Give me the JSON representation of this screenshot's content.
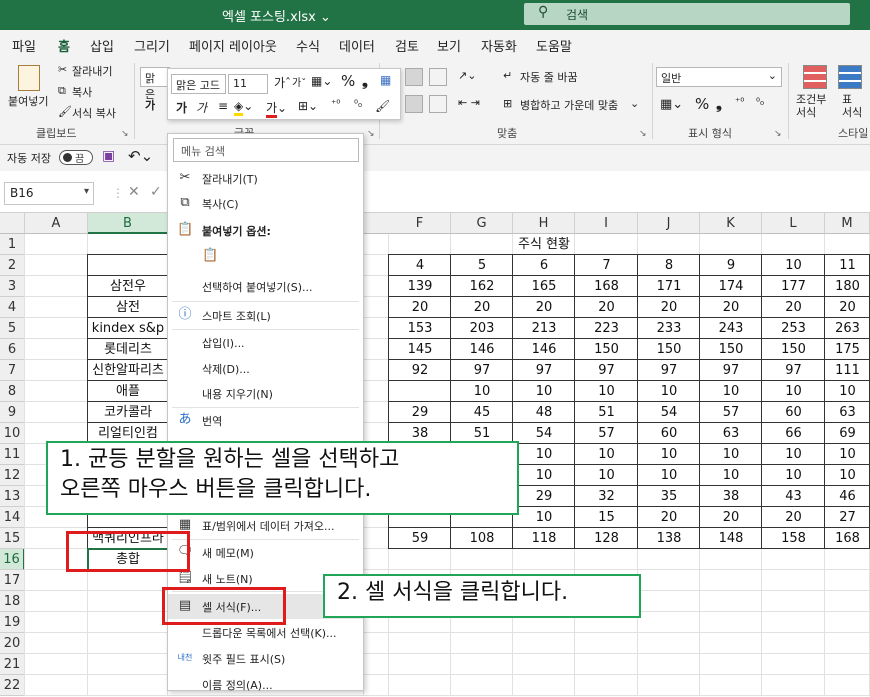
{
  "title_bar": {
    "title": "엑셀 포스팅.xlsx ⌄",
    "search_placeholder": "검색"
  },
  "tabs": [
    "파일",
    "홈",
    "삽입",
    "그리기",
    "페이지 레이아웃",
    "수식",
    "데이터",
    "검토",
    "보기",
    "자동화",
    "도움말"
  ],
  "active_tab": "홈",
  "ribbon": {
    "paste": "붙여넣기",
    "cut": "잘라내기",
    "copy": "복사",
    "format_painter": "서식 복사",
    "clipboard": "클립보드",
    "font_group": "글꼴",
    "font_name": "맑은",
    "wrap_text": "자동 줄 바꿈",
    "merge_center": "병합하고 가운데 맞춤",
    "alignment": "맞춤",
    "number_format": "일반",
    "number_group": "표시 형식",
    "conditional_format": "조건부\n서식",
    "table_format": "표\n서식",
    "styles": "스타일"
  },
  "mini_toolbar": {
    "font": "맑은 고드",
    "size": "11"
  },
  "qat": {
    "autosave": "자동 저장",
    "toggle": "끔"
  },
  "name_box": "B16",
  "grid": {
    "columns": [
      "A",
      "B",
      "F",
      "G",
      "H",
      "I",
      "J",
      "K",
      "L",
      "M"
    ],
    "rows": [
      "1",
      "2",
      "3",
      "4",
      "5",
      "6",
      "7",
      "8",
      "9",
      "10",
      "11",
      "12",
      "13",
      "14",
      "15",
      "16",
      "17",
      "18",
      "19",
      "20",
      "21",
      "22"
    ],
    "table_title": "주식 현황",
    "header_numbers": [
      "4",
      "5",
      "6",
      "7",
      "8",
      "9",
      "10",
      "11"
    ],
    "stock_names": [
      "삼전우",
      "삼전",
      "kindex s&p",
      "롯데리츠",
      "신한알파리츠",
      "애플",
      "코카콜라",
      "리얼티인컴",
      "",
      "",
      "",
      "",
      "맥쿼리인프라"
    ],
    "total_label": "총합",
    "data": [
      [
        "139",
        "162",
        "165",
        "168",
        "171",
        "174",
        "177",
        "180"
      ],
      [
        "20",
        "20",
        "20",
        "20",
        "20",
        "20",
        "20",
        "20"
      ],
      [
        "153",
        "203",
        "213",
        "223",
        "233",
        "243",
        "253",
        "263"
      ],
      [
        "145",
        "146",
        "146",
        "150",
        "150",
        "150",
        "150",
        "175"
      ],
      [
        "92",
        "97",
        "97",
        "97",
        "97",
        "97",
        "97",
        "111"
      ],
      [
        "",
        "10",
        "10",
        "10",
        "10",
        "10",
        "10",
        "10"
      ],
      [
        "29",
        "45",
        "48",
        "51",
        "54",
        "57",
        "60",
        "63"
      ],
      [
        "38",
        "51",
        "54",
        "57",
        "60",
        "63",
        "66",
        "69"
      ],
      [
        "",
        "",
        "10",
        "10",
        "10",
        "10",
        "10",
        "10"
      ],
      [
        "",
        "",
        "10",
        "10",
        "10",
        "10",
        "10",
        "10"
      ],
      [
        "",
        "",
        "29",
        "32",
        "35",
        "38",
        "43",
        "46"
      ],
      [
        "",
        "",
        "10",
        "15",
        "20",
        "20",
        "20",
        "27"
      ],
      [
        "59",
        "108",
        "118",
        "128",
        "138",
        "148",
        "158",
        "168"
      ]
    ]
  },
  "context_menu": {
    "search_placeholder": "메뉴 검색",
    "items": [
      "잘라내기(T)",
      "복사(C)",
      "붙여넣기 옵션:",
      "선택하여 붙여넣기(S)...",
      "스마트 조회(L)",
      "삽입(I)...",
      "삭제(D)...",
      "내용 지우기(N)",
      "번역",
      "표/범위에서 데이터 가져오...",
      "새 메모(M)",
      "새 노트(N)",
      "셀 서식(F)...",
      "드롭다운 목록에서 선택(K)...",
      "윗주 필드 표시(S)",
      "이름 정의(A)..."
    ]
  },
  "annotations": {
    "note1": "1. 균등 분할을 원하는 셀을 선택하고\n오른쪽 마우스 버튼을 클릭합니다.",
    "note2": "2. 셀 서식을 클릭합니다."
  },
  "colors": {
    "excel_green": "#217346",
    "callout_border": "#21a557",
    "highlight_red": "#e01b1b"
  }
}
